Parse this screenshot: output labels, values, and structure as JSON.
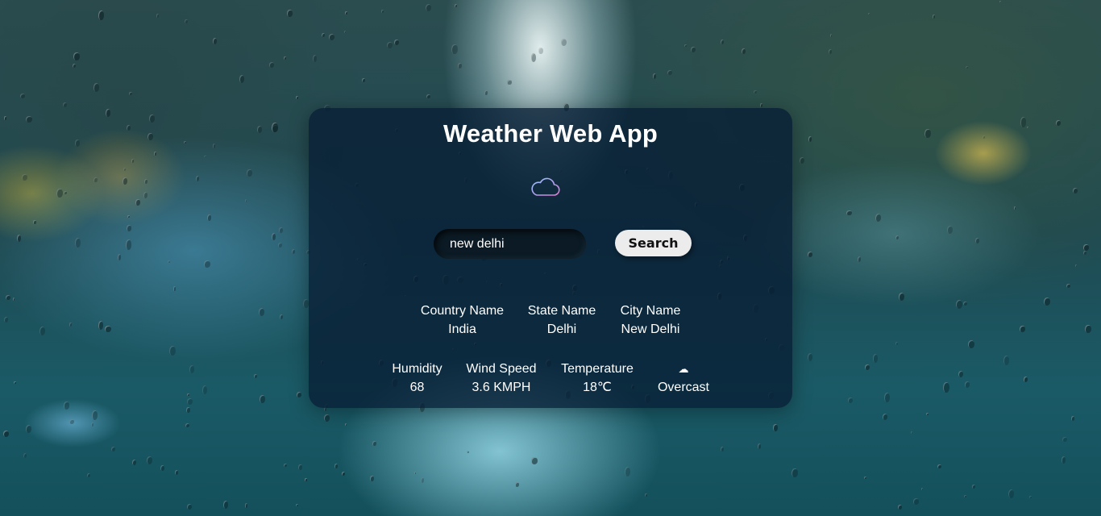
{
  "app": {
    "title": "Weather Web App",
    "icon": "cloud-icon"
  },
  "search": {
    "value": "new delhi",
    "button_label": "Search"
  },
  "location": {
    "country_label": "Country Name",
    "country_value": "India",
    "state_label": "State Name",
    "state_value": "Delhi",
    "city_label": "City Name",
    "city_value": "New Delhi"
  },
  "weather": {
    "humidity_label": "Humidity",
    "humidity_value": "68",
    "wind_label": "Wind Speed",
    "wind_value": "3.6 KMPH",
    "temperature_label": "Temperature",
    "temperature_value": "18℃",
    "condition_icon": "☁",
    "condition_value": "Overcast"
  },
  "colors": {
    "card_background": "#081e34",
    "button_background": "#ececec",
    "text": "#ffffff"
  }
}
